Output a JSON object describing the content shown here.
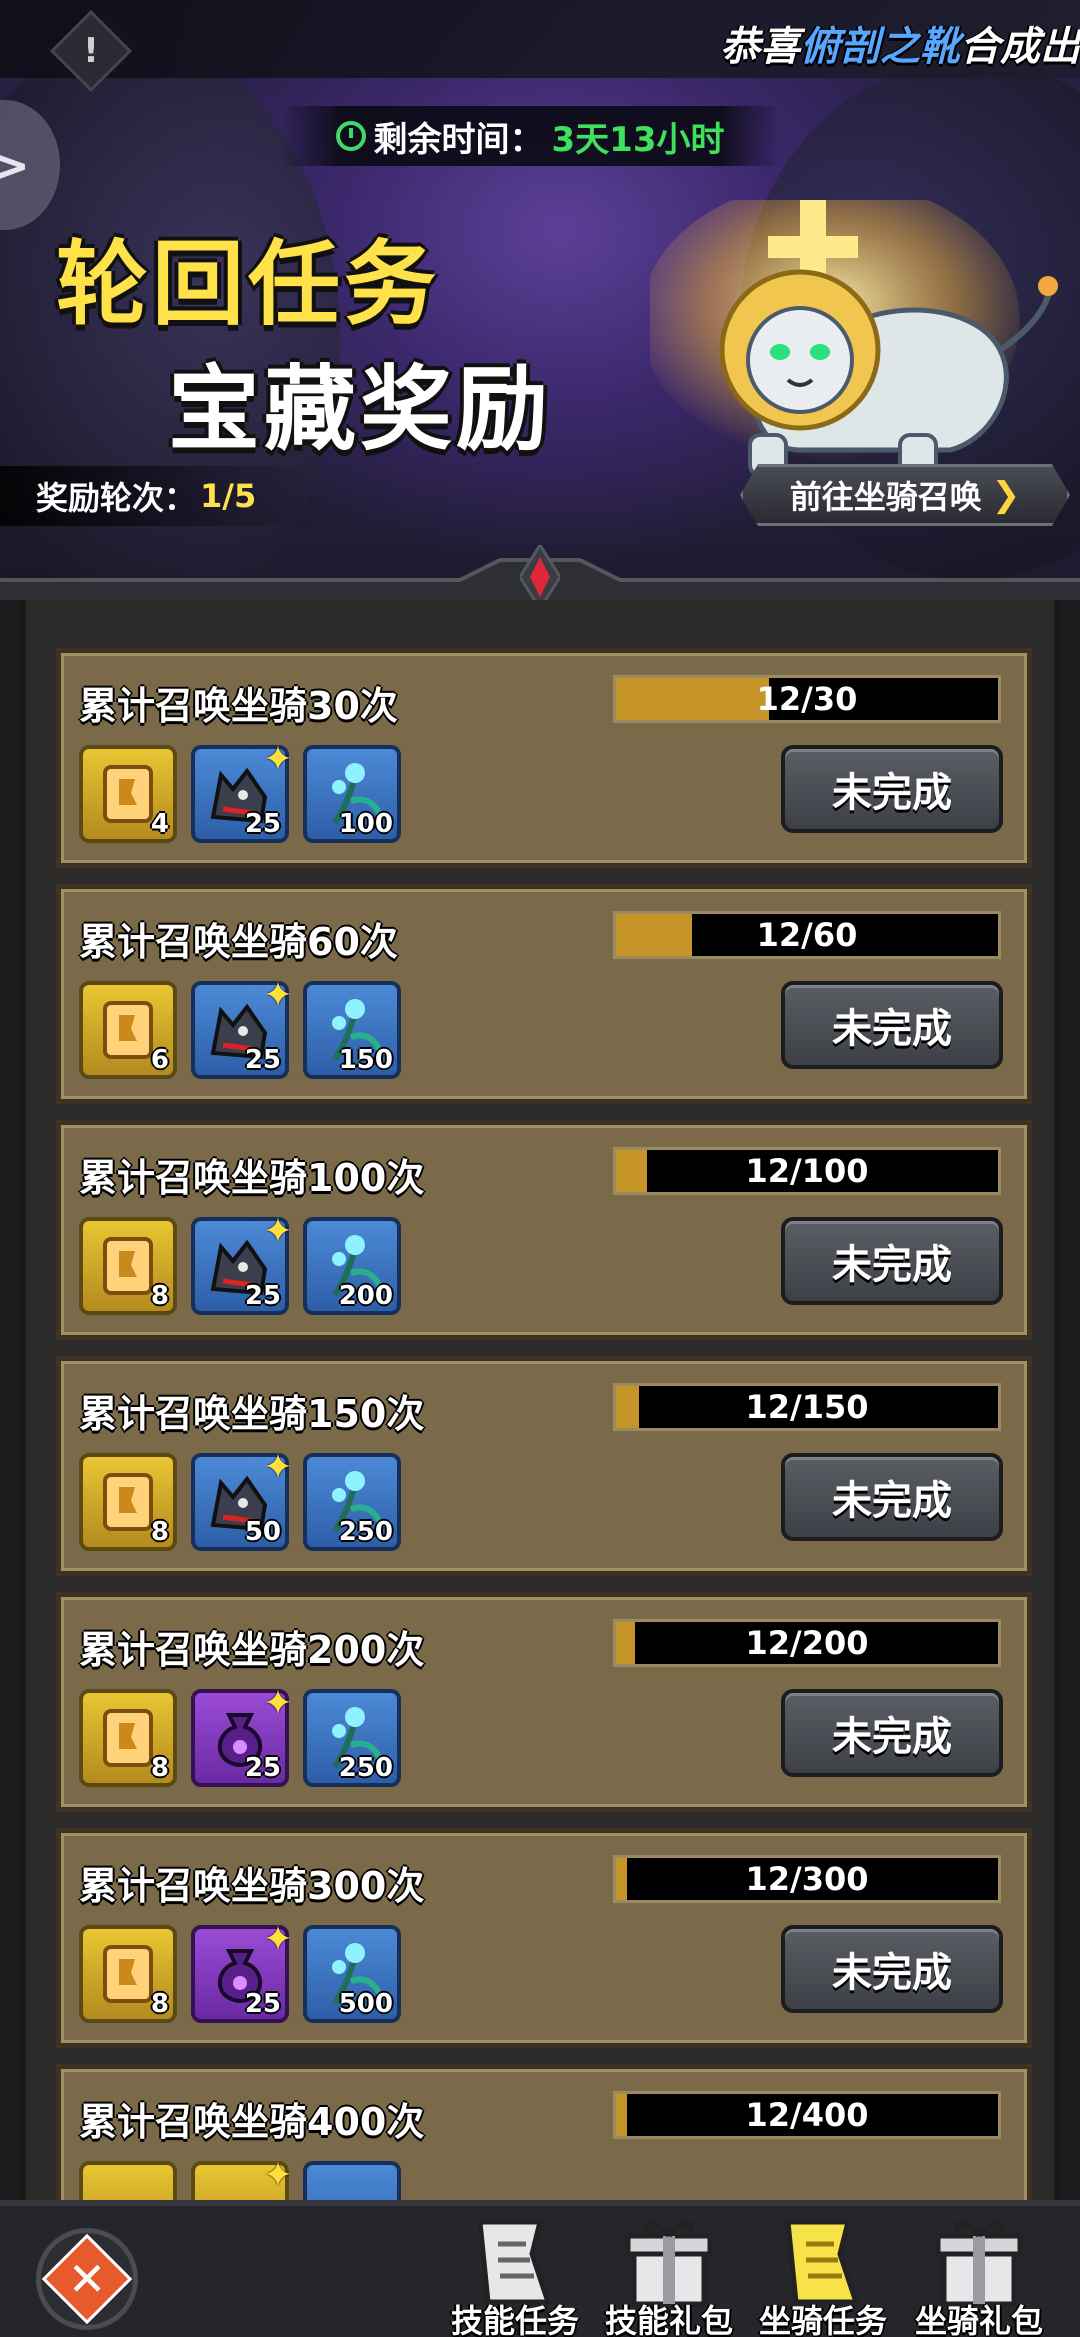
{
  "notice": {
    "prefix": "恭喜",
    "item": "俯剖之靴",
    "suffix": "合成出"
  },
  "timer": {
    "label": "剩余时间：",
    "value": "3天13小时"
  },
  "banner": {
    "title_line1": "轮回任务",
    "title_line2": "宝藏奖励",
    "round_label": "奖励轮次：",
    "round_value": "1/5",
    "goto_label": "前往坐骑召唤"
  },
  "tasks": [
    {
      "title": "累计召唤坐骑30次",
      "progress_text": "12/30",
      "progress": 0.4,
      "rewards": [
        {
          "icon": "scroll-icon",
          "qty": "4"
        },
        {
          "icon": "wolf-mount-icon",
          "qty": "25"
        },
        {
          "icon": "herb-icon",
          "qty": "100"
        }
      ],
      "status": "未完成"
    },
    {
      "title": "累计召唤坐骑60次",
      "progress_text": "12/60",
      "progress": 0.2,
      "rewards": [
        {
          "icon": "scroll-icon",
          "qty": "6"
        },
        {
          "icon": "wolf-mount-icon",
          "qty": "25"
        },
        {
          "icon": "herb-icon",
          "qty": "150"
        }
      ],
      "status": "未完成"
    },
    {
      "title": "累计召唤坐骑100次",
      "progress_text": "12/100",
      "progress": 0.12,
      "rewards": [
        {
          "icon": "scroll-icon",
          "qty": "8"
        },
        {
          "icon": "wolf-mount-icon",
          "qty": "25"
        },
        {
          "icon": "herb-icon",
          "qty": "200"
        }
      ],
      "status": "未完成"
    },
    {
      "title": "累计召唤坐骑150次",
      "progress_text": "12/150",
      "progress": 0.08,
      "rewards": [
        {
          "icon": "scroll-icon",
          "qty": "8"
        },
        {
          "icon": "wolf-mount-icon",
          "qty": "50"
        },
        {
          "icon": "herb-icon",
          "qty": "250"
        }
      ],
      "status": "未完成"
    },
    {
      "title": "累计召唤坐骑200次",
      "progress_text": "12/200",
      "progress": 0.06,
      "rewards": [
        {
          "icon": "scroll-icon",
          "qty": "8"
        },
        {
          "icon": "purple-bag-icon",
          "qty": "25"
        },
        {
          "icon": "herb-icon",
          "qty": "250"
        }
      ],
      "status": "未完成"
    },
    {
      "title": "累计召唤坐骑300次",
      "progress_text": "12/300",
      "progress": 0.04,
      "rewards": [
        {
          "icon": "scroll-icon",
          "qty": "8"
        },
        {
          "icon": "purple-bag-icon",
          "qty": "25"
        },
        {
          "icon": "herb-icon",
          "qty": "500"
        }
      ],
      "status": "未完成"
    },
    {
      "title": "累计召唤坐骑400次",
      "progress_text": "12/400",
      "progress": 0.03,
      "rewards": [],
      "status": ""
    }
  ],
  "nav": {
    "tabs": [
      {
        "label": "技能任务",
        "icon": "scroll-tab-icon"
      },
      {
        "label": "技能礼包",
        "icon": "gift-tab-icon"
      },
      {
        "label": "坐骑任务",
        "icon": "scroll-tab-icon"
      },
      {
        "label": "坐骑礼包",
        "icon": "gift-tab-icon"
      }
    ]
  },
  "colors": {
    "accent_yellow": "#ffe14a",
    "timer_green": "#3fe05c",
    "progress_fill": "#c6952a",
    "card_bg": "#7b6a49"
  }
}
